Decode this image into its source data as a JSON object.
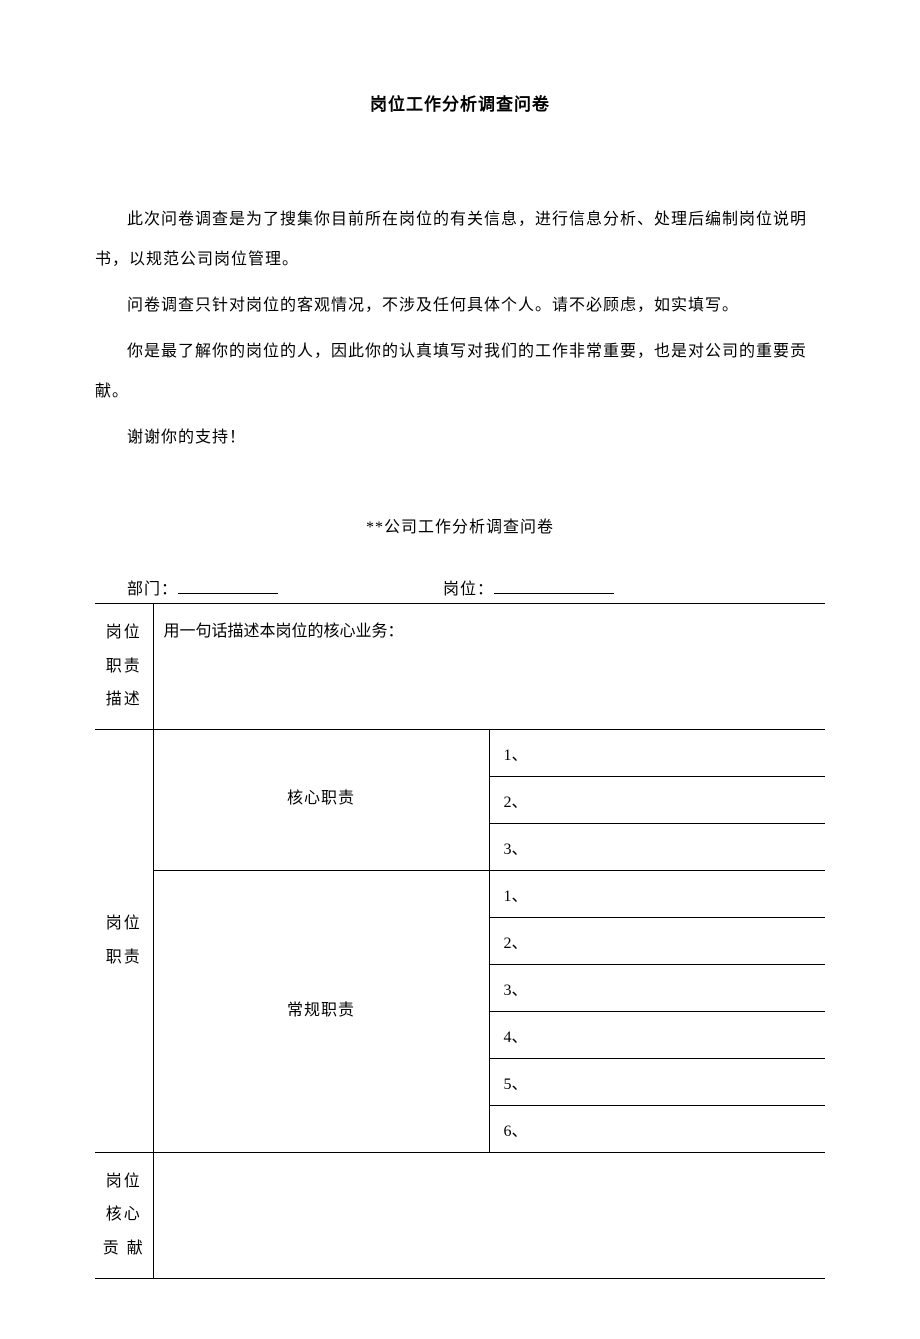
{
  "title": "岗位工作分析调查问卷",
  "intro": {
    "p1": "此次问卷调查是为了搜集你目前所在岗位的有关信息，进行信息分析、处理后编制岗位说明书，以规范公司岗位管理。",
    "p2": "问卷调查只针对岗位的客观情况，不涉及任何具体个人。请不必顾虑，如实填写。",
    "p3": "你是最了解你的岗位的人，因此你的认真填写对我们的工作非常重要，也是对公司的重要贡献。",
    "p4": "谢谢你的支持！"
  },
  "subtitle": "**公司工作分析调查问卷",
  "fields": {
    "dept_label": "部门：",
    "dept_value": "",
    "position_label": "岗位：",
    "position_value": ""
  },
  "table": {
    "row1": {
      "label": "岗位职责描述",
      "content": "用一句话描述本岗位的核心业务："
    },
    "row2": {
      "label": "岗位职责",
      "core_label": "核心职责",
      "core_items": [
        "1、",
        "2、",
        "3、"
      ],
      "routine_label": "常规职责",
      "routine_items": [
        "1、",
        "2、",
        "3、",
        "4、",
        "5、",
        "6、"
      ]
    },
    "row3": {
      "label_line1": "岗位",
      "label_line2": "核心",
      "label_line3": "贡 献"
    }
  }
}
